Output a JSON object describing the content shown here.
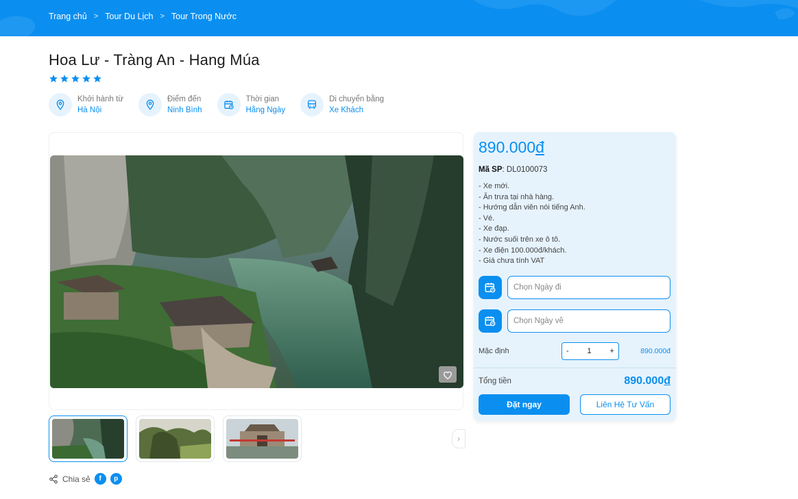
{
  "breadcrumb": [
    {
      "label": "Trang chủ"
    },
    {
      "label": "Tour Du Lịch"
    },
    {
      "label": "Tour Trong Nước"
    }
  ],
  "breadcrumb_separator": ">",
  "tour": {
    "title": "Hoa Lư - Tràng An - Hang Múa",
    "rating": 5,
    "rating_max": 5
  },
  "meta": [
    {
      "icon": "location-pin-icon",
      "label": "Khởi hành từ",
      "value": "Hà Nội"
    },
    {
      "icon": "location-pin-icon",
      "label": "Điểm đến",
      "value": "Ninh Bình"
    },
    {
      "icon": "calendar-clock-icon",
      "label": "Thời gian",
      "value": "Hằng Ngày"
    },
    {
      "icon": "bus-icon",
      "label": "Di chuyển bằng",
      "value": "Xe Khách"
    }
  ],
  "booking": {
    "price": "890.000",
    "currency": "đ",
    "sku_label": "Mã SP",
    "sku_value": "DL0100073",
    "inclusions": [
      "- Xe mới.",
      "- Ăn trưa tại nhà hàng.",
      "- Hướng dẫn viên nói tiếng Anh.",
      "- Vé.",
      "- Xe đạp.",
      "- Nước suối trên xe ô tô.",
      "- Xe điện 100.000đ/khách.",
      "- Giá chưa tính VAT"
    ],
    "depart_placeholder": "Chọn Ngày đi",
    "return_placeholder": "Chọn Ngày về",
    "qty_label": "Mặc định",
    "qty_minus": "-",
    "qty_value": "1",
    "qty_plus": "+",
    "qty_subtotal": "890.000đ",
    "total_label": "Tổng tiền",
    "total_amount": "890.000",
    "total_currency": "đ",
    "book_button": "Đặt ngay",
    "contact_button": "Liên Hệ Tư Vấn"
  },
  "share": {
    "label": "Chia sẻ",
    "facebook": "f",
    "pinterest": "p"
  },
  "colors": {
    "brand": "#0a8ff0",
    "panel": "#e6f3fd"
  }
}
